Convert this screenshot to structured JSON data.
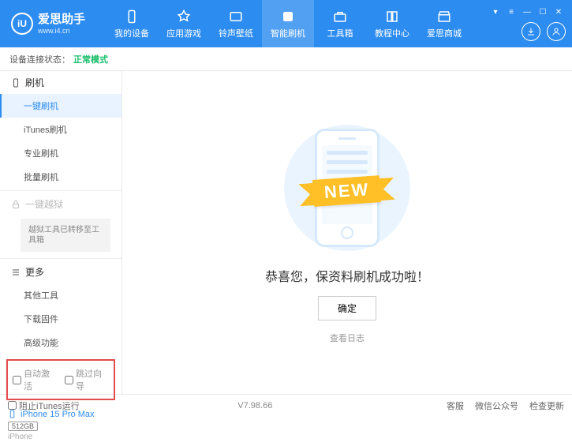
{
  "brand": {
    "title": "爱思助手",
    "url": "www.i4.cn",
    "logo_letter": "iU"
  },
  "nav": {
    "items": [
      {
        "label": "我的设备"
      },
      {
        "label": "应用游戏"
      },
      {
        "label": "铃声壁纸"
      },
      {
        "label": "智能刷机"
      },
      {
        "label": "工具箱"
      },
      {
        "label": "教程中心"
      },
      {
        "label": "爱思商城"
      }
    ],
    "active_index": 3
  },
  "status": {
    "label": "设备连接状态：",
    "mode": "正常模式"
  },
  "sidebar": {
    "flash": {
      "title": "刷机",
      "items": [
        "一键刷机",
        "iTunes刷机",
        "专业刷机",
        "批量刷机"
      ],
      "active_index": 0
    },
    "jailbreak": {
      "title": "一键越狱",
      "note": "越狱工具已转移至工具箱"
    },
    "more": {
      "title": "更多",
      "items": [
        "其他工具",
        "下载固件",
        "高级功能"
      ]
    },
    "options": {
      "auto_activate": "自动激活",
      "skip_guide": "跳过向导"
    },
    "device": {
      "name": "iPhone 15 Pro Max",
      "storage": "512GB",
      "type": "iPhone"
    }
  },
  "main": {
    "ribbon": "NEW",
    "success": "恭喜您，保资料刷机成功啦！",
    "ok": "确定",
    "view_log": "查看日志"
  },
  "footer": {
    "block_itunes": "阻止iTunes运行",
    "version": "V7.98.66",
    "links": [
      "客服",
      "微信公众号",
      "检查更新"
    ]
  }
}
